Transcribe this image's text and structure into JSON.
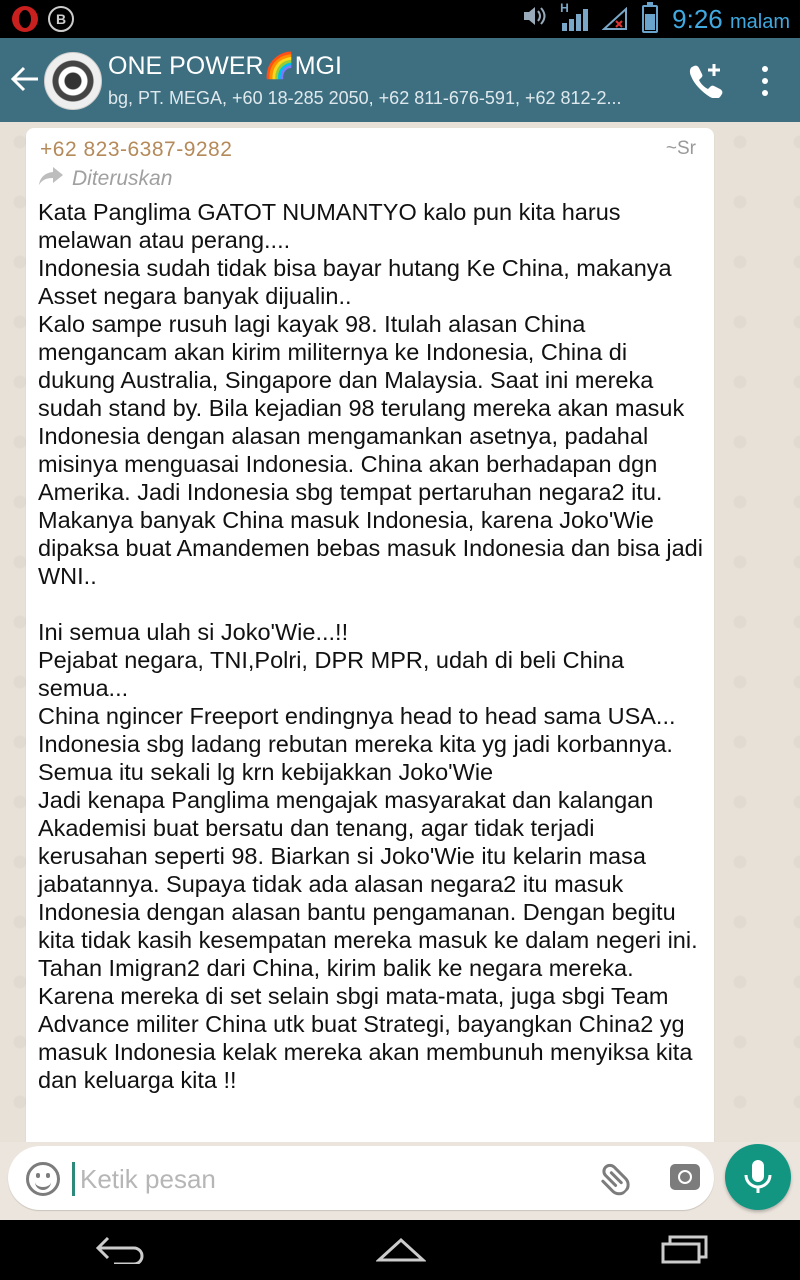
{
  "status_bar": {
    "time": "9:26",
    "time_suffix": "malam",
    "network_label": "H"
  },
  "header": {
    "title": "ONE POWER🌈MGI",
    "subtitle": "bg, PT.  MEGA, +60 18-285 2050, +62 811-676-591, +62 812-2..."
  },
  "message": {
    "sender_phone": "+62 823-6387-9282",
    "sender_name": "~Sr",
    "forwarded_label": "Diteruskan",
    "text": "Kata Panglima GATOT NUMANTYO kalo pun kita harus melawan atau perang....\nIndonesia sudah tidak bisa bayar hutang Ke China, makanya Asset negara banyak dijualin..\nKalo sampe rusuh lagi kayak 98. Itulah alasan China mengancam akan kirim militernya ke Indonesia, China di dukung Australia, Singapore dan Malaysia. Saat ini mereka sudah stand by. Bila kejadian 98 terulang mereka akan masuk Indonesia dengan alasan mengamankan asetnya, padahal misinya menguasai Indonesia. China akan berhadapan dgn Amerika. Jadi Indonesia sbg tempat pertaruhan negara2 itu.\nMakanya banyak China masuk Indonesia, karena Joko'Wie dipaksa buat Amandemen bebas masuk Indonesia dan bisa jadi WNI..\n\nIni semua ulah si Joko'Wie...!!\nPejabat negara, TNI,Polri, DPR MPR, udah di beli China semua...\nChina ngincer Freeport endingnya head to head sama USA...\nIndonesia sbg ladang rebutan mereka kita yg jadi korbannya.\nSemua itu sekali lg krn kebijakkan Joko'Wie\nJadi kenapa Panglima mengajak masyarakat dan kalangan Akademisi buat bersatu dan tenang, agar tidak terjadi kerusahan seperti 98. Biarkan si Joko'Wie itu kelarin masa jabatannya. Supaya tidak ada alasan negara2 itu masuk Indonesia dengan alasan bantu pengamanan. Dengan begitu kita tidak kasih kesempatan mereka masuk ke dalam negeri ini.\nTahan Imigran2 dari China, kirim balik ke negara mereka.\nKarena mereka di set selain sbgi mata-mata, juga sbgi Team Advance militer China utk buat Strategi, bayangkan China2 yg masuk Indonesia kelak mereka akan membunuh menyiksa kita dan keluarga kita !!"
  },
  "composer": {
    "placeholder": "Ketik pesan"
  }
}
